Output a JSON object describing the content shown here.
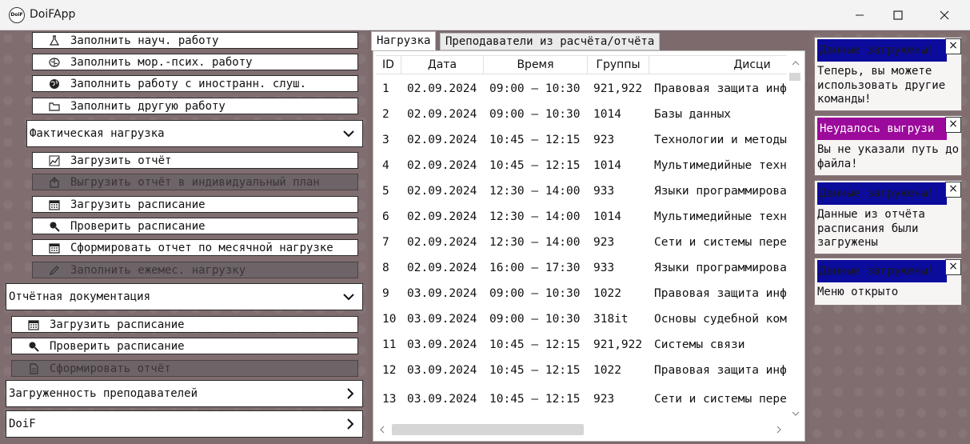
{
  "app": {
    "title": "DoiFApp",
    "icon_text": "DoiF"
  },
  "menu": {
    "top_items": [
      {
        "label": "Заполнить науч. работу",
        "icon": "flask-icon",
        "disabled": false
      },
      {
        "label": "Заполнить мор.-псих. работу",
        "icon": "brain-icon",
        "disabled": false
      },
      {
        "label": "Заполнить работу с иностранн. слуш.",
        "icon": "globe-icon",
        "disabled": false
      },
      {
        "label": "Заполнить другую работу",
        "icon": "folder-icon",
        "disabled": false
      }
    ],
    "actual_load": {
      "label": "Фактическая нагрузка",
      "items": [
        {
          "label": "Загрузить отчёт",
          "icon": "chart-icon",
          "disabled": false
        },
        {
          "label": "Выгрузить отчёт в индивидуальный план",
          "icon": "export-icon",
          "disabled": true
        },
        {
          "label": "Загрузить расписание",
          "icon": "calendar-icon",
          "disabled": false
        },
        {
          "label": "Проверить расписание",
          "icon": "magnifier-icon",
          "disabled": false
        },
        {
          "label": "Сформировать отчет по месячной нагрузке",
          "icon": "calendar-icon",
          "disabled": false
        },
        {
          "label": "Заполнить ежемес. нагрузку",
          "icon": "pencil-icon",
          "disabled": true
        }
      ]
    },
    "reporting_docs": {
      "label": "Отчётная документация",
      "items": [
        {
          "label": "Загрузить расписание",
          "icon": "calendar-icon",
          "disabled": false
        },
        {
          "label": "Проверить расписание",
          "icon": "magnifier-icon",
          "disabled": false
        },
        {
          "label": "Сформировать отчёт",
          "icon": "document-icon",
          "disabled": true
        }
      ]
    },
    "teacher_load": {
      "label": "Загруженность преподавателей"
    },
    "doif": {
      "label": "DoiF"
    }
  },
  "tabs": [
    {
      "label": "Нагрузка",
      "active": true
    },
    {
      "label": "Преподаватели из расчёта/отчёта",
      "active": false
    }
  ],
  "table": {
    "headers": [
      "ID",
      "Дата",
      "Время",
      "Группы",
      "Дисци"
    ],
    "rows": [
      [
        "1",
        "02.09.2024",
        "09:00 – 10:30",
        "921,922",
        "Правовая защита инф"
      ],
      [
        "2",
        "02.09.2024",
        "09:00 – 10:30",
        "1014",
        "Базы данных"
      ],
      [
        "3",
        "02.09.2024",
        "10:45 – 12:15",
        "923",
        "Технологии и методы"
      ],
      [
        "4",
        "02.09.2024",
        "10:45 – 12:15",
        "1014",
        "Мультимедийные техн"
      ],
      [
        "5",
        "02.09.2024",
        "12:30 – 14:00",
        "933",
        "Языки программирова"
      ],
      [
        "6",
        "02.09.2024",
        "12:30 – 14:00",
        "1014",
        "Мультимедийные техн"
      ],
      [
        "7",
        "02.09.2024",
        "12:30 – 14:00",
        "923",
        "Сети и системы пере"
      ],
      [
        "8",
        "02.09.2024",
        "16:00 – 17:30",
        "933",
        "Языки программирова"
      ],
      [
        "9",
        "03.09.2024",
        "09:00 – 10:30",
        "1022",
        "Правовая защита инф"
      ],
      [
        "10",
        "03.09.2024",
        "09:00 – 10:30",
        "318it",
        "Основы судебной ком"
      ],
      [
        "11",
        "03.09.2024",
        "10:45 – 12:15",
        "921,922",
        "Системы связи"
      ],
      [
        "12",
        "03.09.2024",
        "10:45 – 12:15",
        "1022",
        "Правовая защита инф"
      ],
      [
        "13",
        "03.09.2024",
        "10:45 – 12:15",
        "923",
        "Сети и системы пере"
      ]
    ]
  },
  "notifications": [
    {
      "title": "Данные загружены!",
      "body": "Теперь, вы можете использовать другие команды!",
      "color": "#0b0b9c",
      "title_color": "#1a1a1a"
    },
    {
      "title": "Неудалось выгрузи",
      "body": "Вы не указали путь до файла!",
      "color": "#9c0a9c",
      "title_color": "#ffffff"
    },
    {
      "title": "Данные загружены!",
      "body": "Данные из отчёта расписания были загружены",
      "color": "#0b0b9c",
      "title_color": "#1a1a1a"
    },
    {
      "title": "Данные загружены!",
      "body": "Меню открыто",
      "color": "#0b0b9c",
      "title_color": "#1a1a1a"
    }
  ],
  "colors": {
    "pane_bg": "#806d6f",
    "disabled_bg": "#6d6467"
  }
}
